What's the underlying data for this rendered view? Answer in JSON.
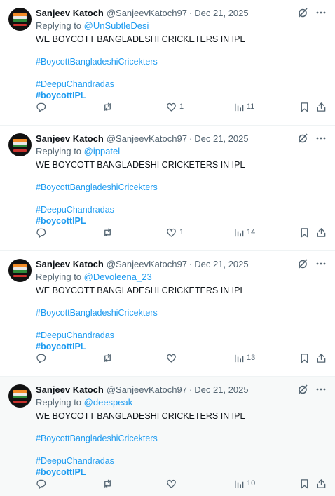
{
  "tweets": [
    {
      "name": "Sanjeev Katoch",
      "handle": "@SanjeevKatoch97",
      "separator": "·",
      "date": "Dec 21, 2025",
      "replying_prefix": "Replying to ",
      "replying_to": "@UnSubtleDesi",
      "text": "WE BOYCOTT BANGLADESHI CRICKETERS IN IPL",
      "hashtag1": "#BoycottBangladeshiCricekters",
      "hashtag2": "#DeepuChandradas",
      "hashtag3": "#boycottIPL",
      "likes": "1",
      "views": "11",
      "highlighted": false
    },
    {
      "name": "Sanjeev Katoch",
      "handle": "@SanjeevKatoch97",
      "separator": "·",
      "date": "Dec 21, 2025",
      "replying_prefix": "Replying to ",
      "replying_to": "@ippatel",
      "text": "WE BOYCOTT BANGLADESHI CRICKETERS IN IPL",
      "hashtag1": "#BoycottBangladeshiCricekters",
      "hashtag2": "#DeepuChandradas",
      "hashtag3": "#boycottIPL",
      "likes": "1",
      "views": "14",
      "highlighted": false
    },
    {
      "name": "Sanjeev Katoch",
      "handle": "@SanjeevKatoch97",
      "separator": "·",
      "date": "Dec 21, 2025",
      "replying_prefix": "Replying to ",
      "replying_to": "@Devoleena_23",
      "text": "WE BOYCOTT BANGLADESHI CRICKETERS IN IPL",
      "hashtag1": "#BoycottBangladeshiCricekters",
      "hashtag2": "#DeepuChandradas",
      "hashtag3": "#boycottIPL",
      "likes": "",
      "views": "13",
      "highlighted": false
    },
    {
      "name": "Sanjeev Katoch",
      "handle": "@SanjeevKatoch97",
      "separator": "·",
      "date": "Dec 21, 2025",
      "replying_prefix": "Replying to ",
      "replying_to": "@deespeak",
      "text": "WE BOYCOTT BANGLADESHI CRICKETERS IN IPL",
      "hashtag1": "#BoycottBangladeshiCricekters",
      "hashtag2": "#DeepuChandradas",
      "hashtag3": "#boycottIPL",
      "likes": "",
      "views": "10",
      "highlighted": true
    }
  ],
  "icons": {
    "grok": "grok-icon",
    "more": "more-icon",
    "reply": "reply-icon",
    "retweet": "retweet-icon",
    "like": "heart-icon",
    "views": "views-icon",
    "bookmark": "bookmark-icon",
    "share": "share-icon"
  },
  "colors": {
    "link": "#1d9bf0",
    "muted": "#536471",
    "text": "#0f1419",
    "highlight_bg": "#f7f9f9"
  }
}
